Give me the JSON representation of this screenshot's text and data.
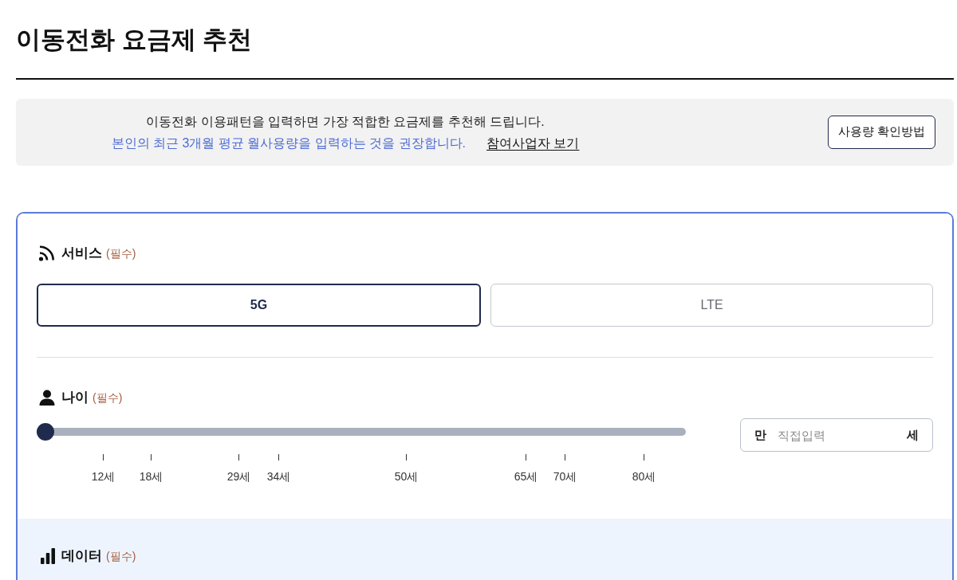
{
  "page_title": "이동전화 요금제 추천",
  "notice": {
    "line_1": "이동전화 이용패턴을 입력하면 가장 적합한 요금제를 추천해 드립니다.",
    "line_2": "본인의 최근 3개월 평균 월사용량을 입력하는 것을 권장합니다.",
    "link": "참여사업자 보기",
    "button": "사용량 확인방법"
  },
  "form": {
    "sections": [
      {
        "kind": "service",
        "title": "서비스",
        "required_mark": "(필수)",
        "highlighted": false,
        "options": [
          {
            "label": "5G",
            "selected": true
          },
          {
            "label": "LTE",
            "selected": false
          }
        ]
      },
      {
        "kind": "age",
        "title": "나이",
        "required_mark": "(필수)",
        "highlighted": false,
        "slider": {
          "level": 0,
          "ticks": [
            "12세",
            "18세",
            "29세",
            "34세",
            "50세",
            "65세",
            "70세",
            "80세"
          ]
        },
        "input": {
          "prefix": "만",
          "placeholder": "직접입력",
          "suffix": "세"
        }
      },
      {
        "kind": "data",
        "title": "데이터",
        "required_mark": "(필수)",
        "highlighted": true
      }
    ]
  }
}
